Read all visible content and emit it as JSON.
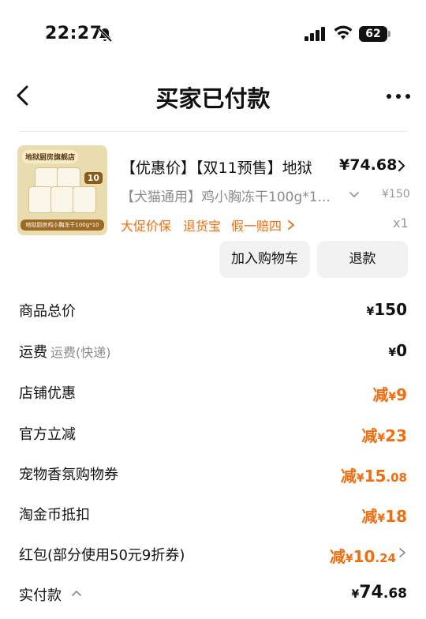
{
  "status_bar": {
    "time": "22:27",
    "battery": "62",
    "icons": [
      "bell-off-icon",
      "signal-icon",
      "wifi-icon",
      "battery-icon"
    ]
  },
  "nav": {
    "title": "买家已付款",
    "back_icon": "chevron-left-icon",
    "more_icon": "more-horizontal-icon"
  },
  "product": {
    "thumbnail": {
      "brand_text": "地狱厨房旗舰店",
      "badge": "10",
      "caption": "地狱厨房鸡小胸冻干100g*10"
    },
    "title": "【优惠价】【双11预售】地狱",
    "price": "¥74.68",
    "spec": "【犬猫通用】鸡小胸冻干100g*1...",
    "original_price": "¥150",
    "promo_tags": [
      "大促价保",
      "退货宝",
      "假一赔四"
    ],
    "quantity": "x1",
    "buttons": {
      "add_to_cart": "加入购物车",
      "refund": "退款"
    }
  },
  "price_rows": [
    {
      "label": "商品总价",
      "sub": "",
      "prefix": "",
      "yen": "¥",
      "int": "150",
      "dec": ""
    },
    {
      "label": "运费",
      "sub": "运费(快递)",
      "prefix": "",
      "yen": "¥",
      "int": "0",
      "dec": ""
    },
    {
      "label": "店铺优惠",
      "sub": "",
      "prefix": "减",
      "yen": "¥",
      "int": "9",
      "dec": ""
    },
    {
      "label": "官方立减",
      "sub": "",
      "prefix": "减",
      "yen": "¥",
      "int": "23",
      "dec": ""
    },
    {
      "label": "宠物香氛购物券",
      "sub": "",
      "prefix": "减",
      "yen": "¥",
      "int": "15",
      "dec": ".08"
    },
    {
      "label": "淘金币抵扣",
      "sub": "",
      "prefix": "减",
      "yen": "¥",
      "int": "18",
      "dec": ""
    },
    {
      "label": "红包(部分使用50元9折券)",
      "sub": "",
      "prefix": "减",
      "yen": "¥",
      "int": "10",
      "dec": ".24"
    },
    {
      "label": "实付款",
      "sub": "",
      "prefix": "",
      "yen": "¥",
      "int": "74",
      "dec": ".68"
    }
  ],
  "colors": {
    "accent_orange": "#f26d0f",
    "muted_gray": "#8c8c8c",
    "button_bg": "#f2f2f2"
  }
}
